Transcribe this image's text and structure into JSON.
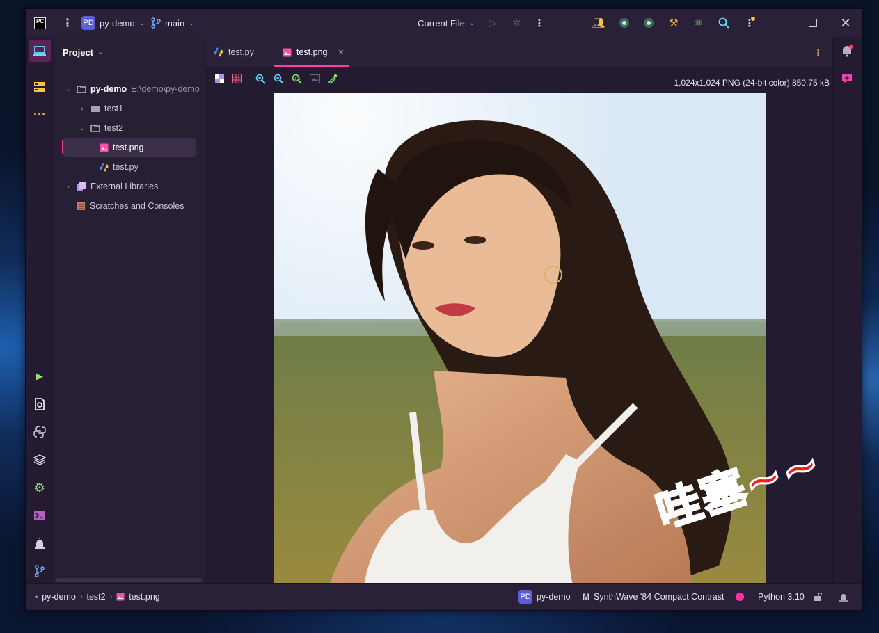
{
  "titlebar": {
    "project_badge": "PD",
    "project_name": "py-demo",
    "branch": "main",
    "run_config": "Current File"
  },
  "tabs": [
    {
      "label": "test.py",
      "icon": "python-file-icon"
    },
    {
      "label": "test.png",
      "icon": "image-file-icon",
      "active": true
    }
  ],
  "project_panel": {
    "title": "Project",
    "tree": [
      {
        "label": "py-demo",
        "path": "E:\\demo\\py-demo"
      },
      {
        "label": "test1"
      },
      {
        "label": "test2"
      },
      {
        "label": "test.png"
      },
      {
        "label": "test.py"
      },
      {
        "label": "External Libraries"
      },
      {
        "label": "Scratches and Consoles"
      }
    ]
  },
  "image_viewer": {
    "info": "1,024x1,024 PNG (24-bit color) 850.75 kB"
  },
  "overlay_text": "哇塞~~",
  "statusbar": {
    "breadcrumb": [
      "py-demo",
      "test2",
      "test.png"
    ],
    "project_badge": "PD",
    "project_name": "py-demo",
    "theme": "SynthWave '84 Compact Contrast",
    "interpreter": "Python 3.10"
  },
  "colors": {
    "accent_pink": "#ff2fa0",
    "tab_underline": "#ff3fa9",
    "window_bg": "#231c31",
    "titlebar_bg": "#2a2139"
  }
}
